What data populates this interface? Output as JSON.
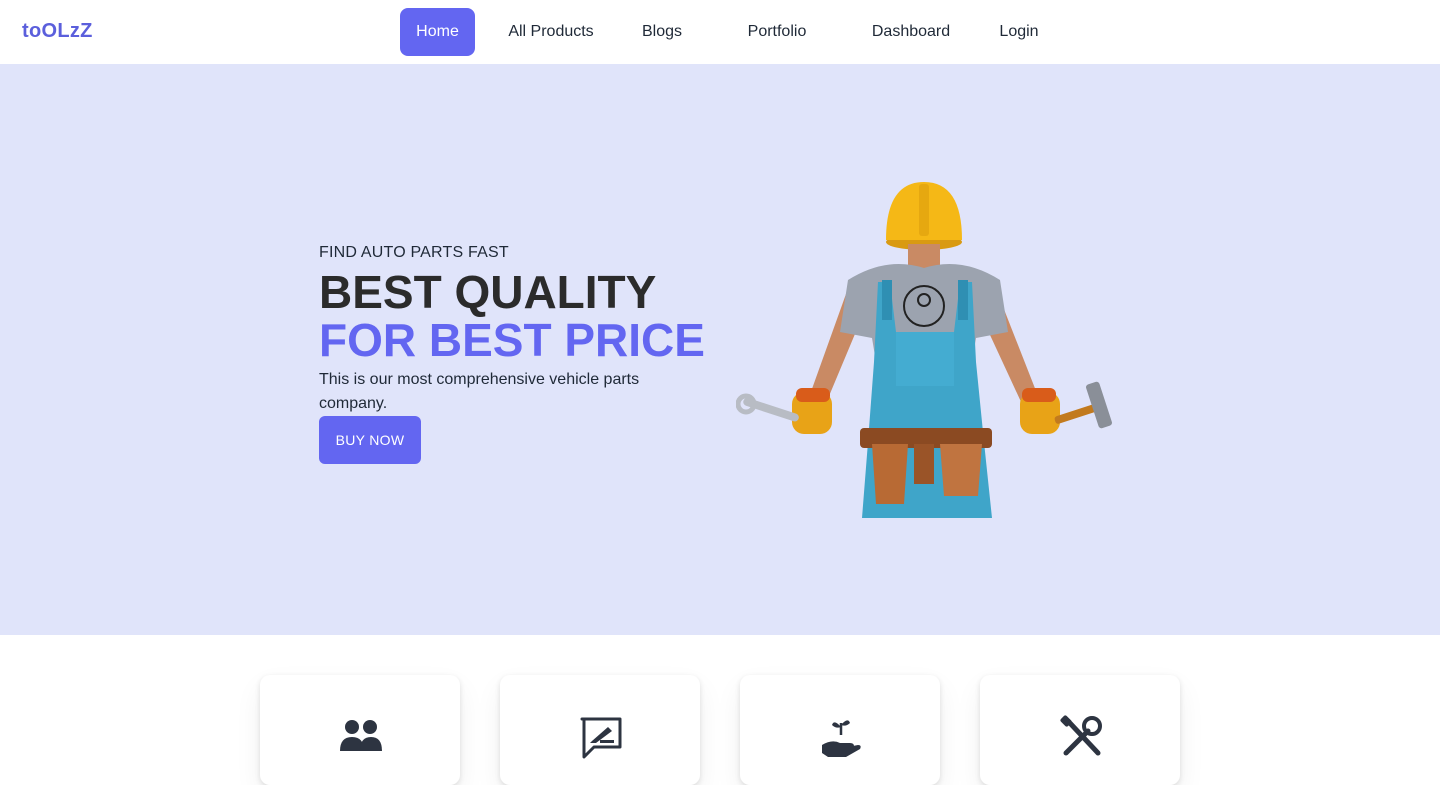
{
  "brand": {
    "name": "toOLzZ",
    "color": "#5b5fdc"
  },
  "nav": {
    "items": [
      {
        "label": "Home",
        "active": true
      },
      {
        "label": "All Products",
        "active": false
      },
      {
        "label": "Blogs",
        "active": false
      },
      {
        "label": "Portfolio",
        "active": false
      },
      {
        "label": "Dashboard",
        "active": false
      },
      {
        "label": "Login",
        "active": false
      }
    ]
  },
  "hero": {
    "eyebrow": "FIND AUTO PARTS FAST",
    "headline_1": "BEST QUALITY",
    "headline_2": "FOR BEST PRICE",
    "tagline": "This is our most comprehensive vehicle parts company.",
    "cta_label": "BUY NOW",
    "image_icon": "worker-with-tools-image"
  },
  "features": {
    "cards": [
      {
        "icon": "users-icon"
      },
      {
        "icon": "review-comment-icon"
      },
      {
        "icon": "hand-plant-icon"
      },
      {
        "icon": "tools-icon"
      }
    ]
  },
  "colors": {
    "accent": "#6366f1",
    "hero_background": "#e0e4fa",
    "headline_dark": "#2b2b2b"
  }
}
